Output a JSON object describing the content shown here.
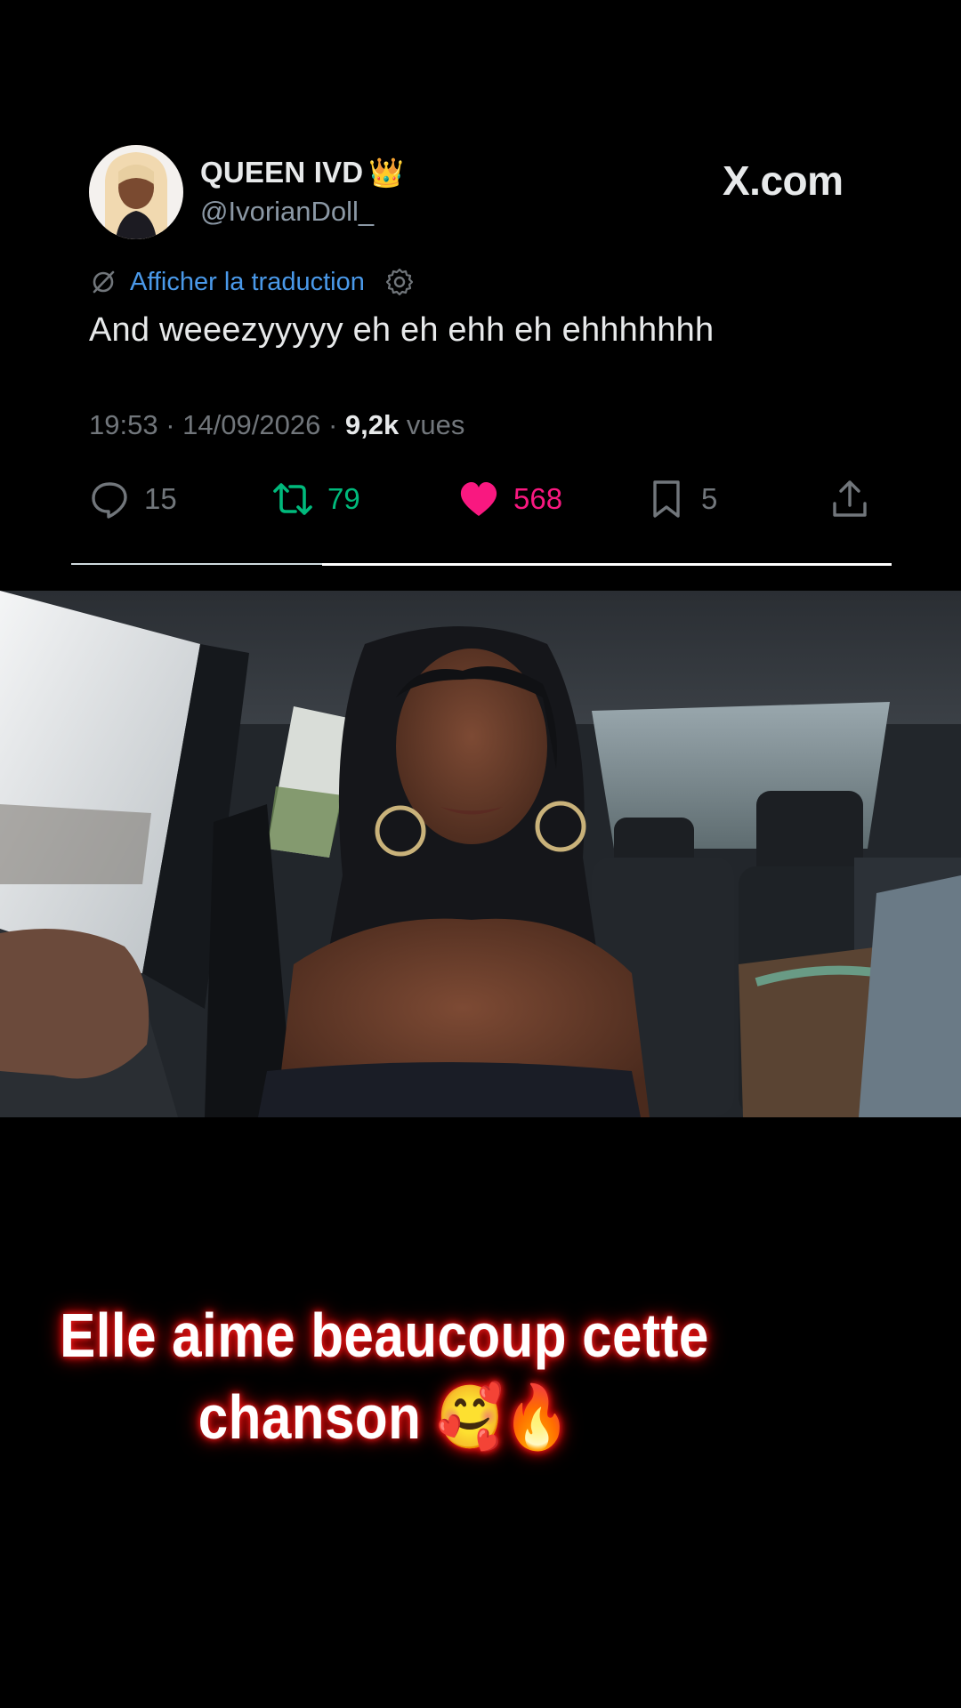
{
  "tweet": {
    "display_name": "QUEEN IVD",
    "name_emoji": "👑",
    "handle": "@IvorianDoll_",
    "brand": "X.com",
    "translate_label": "Afficher la traduction",
    "text": "And weeezyyyyy eh eh ehh eh ehhhhhhh",
    "time": "19:53",
    "date": "14/09/2026",
    "views_count": "9,2k",
    "views_label": "vues",
    "separator": "·",
    "actions": {
      "replies": "15",
      "reposts": "79",
      "likes": "568",
      "bookmarks": "5"
    },
    "colors": {
      "repost": "#00ba7c",
      "like": "#f91880",
      "link": "#4a99e9",
      "muted": "#71767b"
    },
    "icons": [
      "translate-icon",
      "gear-icon",
      "reply-icon",
      "repost-icon",
      "heart-icon",
      "bookmark-icon",
      "share-icon"
    ]
  },
  "caption": {
    "line1": "Elle aime beaucoup cette",
    "line2": "chanson 🥰🔥",
    "glow_color": "#ff2020"
  }
}
